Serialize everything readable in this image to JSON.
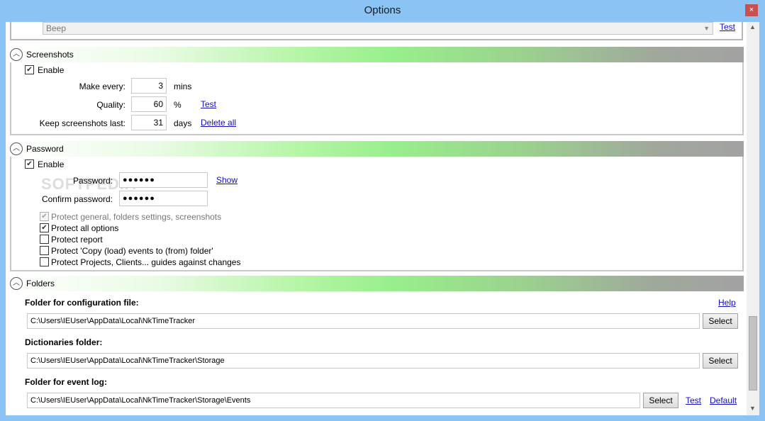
{
  "window": {
    "title": "Options",
    "close_glyph": "×"
  },
  "sound": {
    "selected": "Beep",
    "test_label": "Test"
  },
  "screenshots": {
    "title": "Screenshots",
    "enable_label": "Enable",
    "enable_checked": true,
    "make_every_label": "Make every:",
    "make_every_value": "3",
    "make_every_unit": "mins",
    "quality_label": "Quality:",
    "quality_value": "60",
    "quality_unit": "%",
    "quality_test": "Test",
    "keep_label": "Keep screenshots last:",
    "keep_value": "31",
    "keep_unit": "days",
    "delete_all": "Delete all"
  },
  "password": {
    "title": "Password",
    "enable_label": "Enable",
    "enable_checked": true,
    "password_label": "Password:",
    "password_value": "●●●●●●",
    "show_label": "Show",
    "confirm_label": "Confirm password:",
    "confirm_value": "●●●●●●",
    "options": [
      {
        "label": "Protect general, folders settings, screenshots",
        "checked": true,
        "disabled": true
      },
      {
        "label": "Protect all options",
        "checked": true,
        "disabled": false
      },
      {
        "label": "Protect report",
        "checked": false,
        "disabled": false
      },
      {
        "label": "Protect 'Copy (load) events to (from) folder'",
        "checked": false,
        "disabled": false
      },
      {
        "label": "Protect Projects, Clients... guides against changes",
        "checked": false,
        "disabled": false
      }
    ]
  },
  "folders": {
    "title": "Folders",
    "help_label": "Help",
    "config_label": "Folder for configuration file:",
    "config_path": "C:\\Users\\IEUser\\AppData\\Local\\NkTimeTracker",
    "dict_label": "Dictionaries folder:",
    "dict_path": "C:\\Users\\IEUser\\AppData\\Local\\NkTimeTracker\\Storage",
    "event_label": "Folder for event log:",
    "event_path": "C:\\Users\\IEUser\\AppData\\Local\\NkTimeTracker\\Storage\\Events",
    "select_label": "Select",
    "test_label": "Test",
    "default_label": "Default"
  },
  "watermark": "SOFTPEDIA"
}
